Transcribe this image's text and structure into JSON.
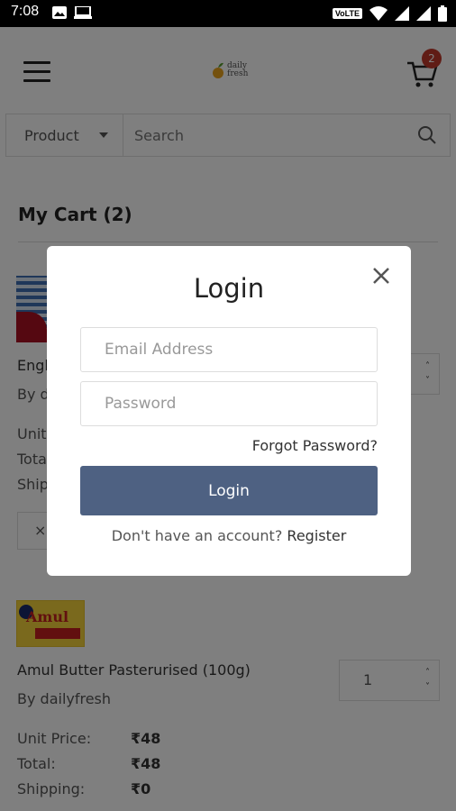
{
  "status_bar": {
    "time": "7:08",
    "network": "VoLTE"
  },
  "header": {
    "logo_text_1": "daily",
    "logo_text_2": "fresh",
    "cart_count": "2"
  },
  "search": {
    "category": "Product",
    "placeholder": "Search"
  },
  "cart": {
    "title": "My Cart (2)",
    "items": [
      {
        "name": "Engl",
        "by": "By da",
        "unit_label": "Unit",
        "total_label": "Tota",
        "shipping_label": "Ship",
        "remove_label": "×"
      },
      {
        "name": "Amul Butter Pasterurised (100g)",
        "by": "By dailyfresh",
        "quantity": "1",
        "unit_price_label": "Unit Price:",
        "unit_price": "₹48",
        "total_label": "Total:",
        "total": "₹48",
        "shipping_label": "Shipping:",
        "shipping": "₹0",
        "image_text": "Amul"
      }
    ]
  },
  "login_modal": {
    "title": "Login",
    "email_placeholder": "Email Address",
    "password_placeholder": "Password",
    "forgot_password": "Forgot Password?",
    "login_button": "Login",
    "no_account_text": "Don't have an account?",
    "register_link": "Register"
  },
  "colors": {
    "primary_button": "#4e6182",
    "badge": "#c0392b"
  }
}
